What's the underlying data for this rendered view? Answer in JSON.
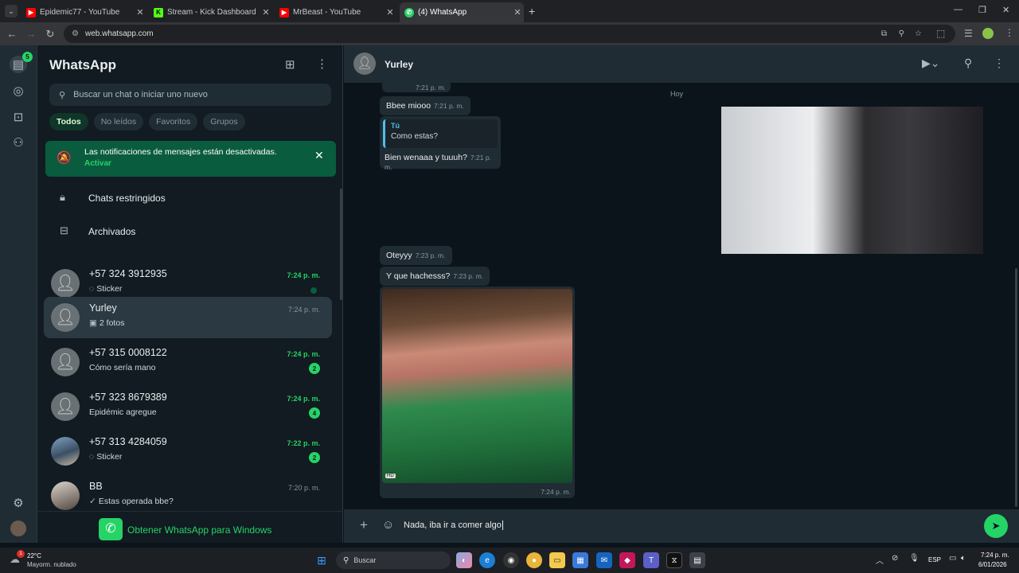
{
  "browser": {
    "tabs": [
      {
        "label": "Epidemic77 - YouTube",
        "favicon": "youtube-icon",
        "color": "#ff0000"
      },
      {
        "label": "Stream - Kick Dashboard",
        "favicon": "kick-icon",
        "color": "#53fc18"
      },
      {
        "label": "MrBeast - YouTube",
        "favicon": "youtube-icon",
        "color": "#ff0000"
      },
      {
        "label": "(4) WhatsApp",
        "favicon": "whatsapp-icon",
        "color": "#25d366"
      }
    ],
    "url": "web.whatsapp.com"
  },
  "rail": {
    "chats_badge": "5"
  },
  "sidebar": {
    "title": "WhatsApp",
    "search_placeholder": "Buscar un chat o iniciar uno nuevo",
    "filters": [
      "Todos",
      "No leídos",
      "Favoritos",
      "Grupos"
    ],
    "notice": {
      "text": "Las notificaciones de mensajes están desactivadas.",
      "action": "Activar"
    },
    "restricted": "Chats restringidos",
    "archived": "Archivados",
    "chats": [
      {
        "name": "+57 324 3912935",
        "preview": "Sticker",
        "time": "7:24 p. m.",
        "badge": "",
        "muted": true
      },
      {
        "name": "Yurley",
        "preview": "2 fotos",
        "time": "7:24 p. m.",
        "badge": ""
      },
      {
        "name": "+57 315 0008122",
        "preview": "Cómo sería mano",
        "time": "7:24 p. m.",
        "badge": "2"
      },
      {
        "name": "+57 323 8679389",
        "preview": "Epidémic agregue",
        "time": "7:24 p. m.",
        "badge": "4"
      },
      {
        "name": "+57 313 4284059",
        "preview": "Sticker",
        "time": "7:22 p. m.",
        "badge": "2"
      },
      {
        "name": "BB",
        "preview": "Estas operada bbe?",
        "time": "7:20 p. m.",
        "badge": ""
      }
    ],
    "get_app": "Obtener WhatsApp para Windows"
  },
  "chat": {
    "contact": "Yurley",
    "date_chip": "Hoy",
    "messages": [
      {
        "time": "7:21 p. m."
      },
      {
        "text": "Bbee miooo",
        "time": "7:21 p. m."
      },
      {
        "quote_author": "Tú",
        "quote_text": "Como estas?",
        "text": "Bien wenaaa y tuuuh?",
        "time": "7:21 p. m."
      },
      {
        "text": "Oteyyy",
        "time": "7:23 p. m."
      },
      {
        "text": "Y que hachesss?",
        "time": "7:23 p. m."
      },
      {
        "image": "photo",
        "hd": "HD",
        "time": "7:24 p. m."
      }
    ],
    "composer_text": "Nada, iba ir a comer algo"
  },
  "taskbar": {
    "weather_temp": "22°C",
    "weather_desc": "Mayorm. nublado",
    "weather_badge": "1",
    "search_placeholder": "Buscar",
    "lang": "ESP",
    "time": "7:24 p. m.",
    "date": "6/01/2026"
  }
}
